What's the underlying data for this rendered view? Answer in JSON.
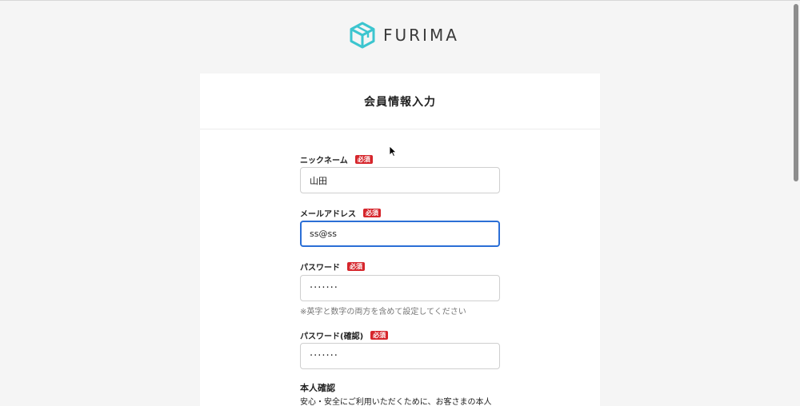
{
  "brand": {
    "name": "FURIMA",
    "logo_icon": "cube-logo-icon",
    "accent_color": "#3cc5cf"
  },
  "form": {
    "title": "会員情報入力",
    "required_badge": "必須",
    "required_color": "#d6262c",
    "fields": {
      "nickname": {
        "label": "ニックネーム",
        "value": "山田"
      },
      "email": {
        "label": "メールアドレス",
        "value": "ss@ss"
      },
      "password": {
        "label": "パスワード",
        "value": "·······",
        "hint": "※英字と数字の両方を含めて設定してください"
      },
      "password_confirm": {
        "label": "パスワード(確認)",
        "value": "·······"
      }
    },
    "identity": {
      "title": "本人確認",
      "description": "安心・安全にご利用いただくために、お客さまの本人"
    }
  },
  "focus_color": "#2b6fd6"
}
